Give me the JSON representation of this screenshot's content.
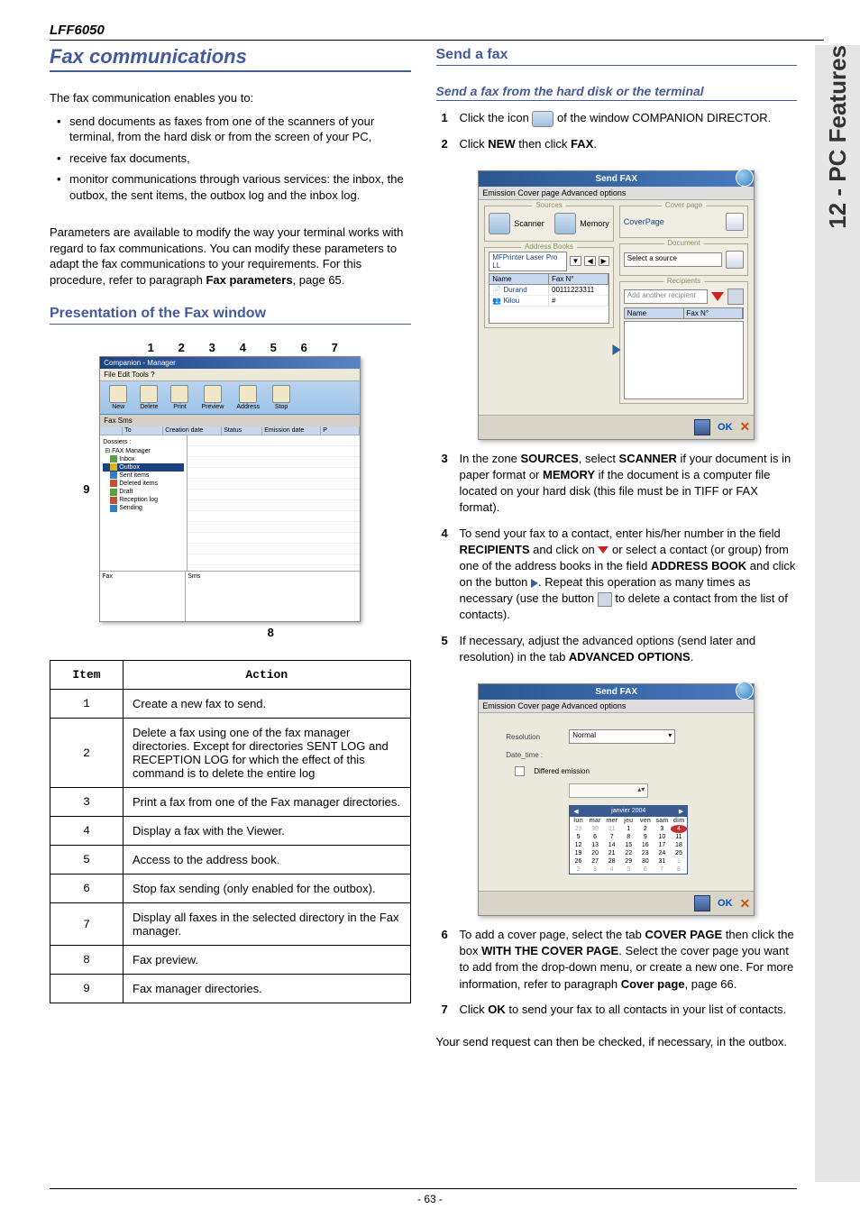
{
  "header_model": "LFF6050",
  "sidebar_text": "12 - PC Features",
  "page_number": "- 63 -",
  "left": {
    "main_title": "Fax communications",
    "intro": "The fax communication enables you to:",
    "bullets": [
      "send documents as faxes from one of the scanners of your terminal, from the hard disk or from the screen of your PC,",
      "receive fax documents,",
      "monitor communications through various services: the inbox, the outbox, the sent items, the outbox log and the inbox log."
    ],
    "params_para_1": "Parameters are available to modify the way your terminal works with regard to fax communications. You can modify these parameters to adapt the fax communications to your requirements. For this procedure, refer to paragraph ",
    "params_para_bold": "Fax parameters",
    "params_para_2": ", page 65.",
    "h2_presentation": "Presentation of the Fax window",
    "fig_top_nums": [
      "1",
      "2",
      "3",
      "4",
      "5",
      "6",
      "7"
    ],
    "fig_left_num": "9",
    "fig_bottom_num": "8",
    "fw": {
      "title": "Companion - Manager",
      "menu": "File   Edit   Tools   ?",
      "tools": [
        "New",
        "Delete",
        "Print",
        "Preview",
        "Address",
        "Stop"
      ],
      "tab_row": "Fax   Sms",
      "headers": [
        "",
        "To",
        "Creation date",
        "Status",
        "Emission date",
        "P"
      ],
      "tree_root": "Dossiers :",
      "tree_parent": "FAX Manager",
      "tree_items": [
        "Inbox",
        "Outbox",
        "Sent items",
        "Deleted items",
        "Draft",
        "Reception log",
        "Sending"
      ],
      "foot_left": "Fax",
      "foot_right": "Sms"
    },
    "table_head_item": "Item",
    "table_head_action": "Action",
    "table_rows": [
      {
        "n": "1",
        "a": "Create a new fax to send."
      },
      {
        "n": "2",
        "a": "Delete a fax using one of the fax manager directories. Except for directories SENT LOG and RECEPTION LOG for which the effect of this command is to delete the entire log"
      },
      {
        "n": "3",
        "a": "Print a fax from one of the Fax manager directories."
      },
      {
        "n": "4",
        "a": "Display a fax with the Viewer."
      },
      {
        "n": "5",
        "a": "Access to the address book."
      },
      {
        "n": "6",
        "a": "Stop fax sending (only enabled for the outbox)."
      },
      {
        "n": "7",
        "a": "Display all faxes in the selected directory in the Fax manager."
      },
      {
        "n": "8",
        "a": "Fax preview."
      },
      {
        "n": "9",
        "a": "Fax manager directories."
      }
    ]
  },
  "right": {
    "h2_send": "Send a fax",
    "h3_send_hdd": "Send a fax from the hard disk or the terminal",
    "step1_a": "Click the icon ",
    "step1_b": " of the window C",
    "step1_c": "OMPANION",
    "step1_d": " D",
    "step1_e": "IRECTOR",
    "step1_f": ".",
    "step2_a": "Click ",
    "step2_b": "NEW",
    "step2_c": " then click ",
    "step2_d": "FAX",
    "step2_e": ".",
    "sfd": {
      "title": "Send FAX",
      "tabs": "Emission   Cover page   Advanced options",
      "group_sources": "Sources",
      "scanner": "Scanner",
      "memory": "Memory",
      "group_addr": "Address Books",
      "addr_header_left": "MFPrinter Laser Pro LL",
      "addr_col_name": "Name",
      "addr_col_fax": "Fax N°",
      "addr_rows": [
        {
          "name": "Durand",
          "fax": "00111223311"
        },
        {
          "name": "Kilou",
          "fax": "#"
        }
      ],
      "group_cover": "Cover page",
      "cover_label": "CoverPage",
      "group_doc": "Document",
      "doc_select": "Select a source",
      "group_recip": "Recipients",
      "recip_add": "Add another recipient",
      "recip_col_name": "Name",
      "recip_col_fax": "Fax N°",
      "ok": "OK",
      "x": "✕"
    },
    "step3": {
      "a": "In the zone ",
      "b": "SOURCES",
      "c": ", select ",
      "d": "SCANNER",
      "e": " if your document is in paper format or ",
      "f": "MEMORY",
      "g": " if the document is a computer file located on your hard disk (this file must be in TIFF or FAX format)."
    },
    "step4": {
      "a": "To send your fax to a contact, enter his/her number in the field ",
      "b": "RECIPIENTS",
      "c": " and click on ",
      "d": " or select a contact (or group) from one of the address books in the field ",
      "e": "ADDRESS BOOK",
      "f": " and click on the button ",
      "g": ". Repeat this operation as many times as necessary (use the button ",
      "h": " to delete a contact from the list of contacts)."
    },
    "step5": {
      "a": "If necessary, adjust the advanced options (send later and resolution) in the tab ",
      "b": "ADVANCED OPTIONS",
      "c": "."
    },
    "adv": {
      "tabs": "Emission   Cover page   Advanced options",
      "label_res": "Resolution",
      "res_value": "Normal",
      "label_date": "Date_time :",
      "check_label": "Differed emission",
      "cal_month": "janvier 2004",
      "cal_dow": [
        "lun",
        "mar",
        "mer",
        "jeu",
        "ven",
        "sam",
        "dim"
      ],
      "cal_days": [
        [
          "29",
          "30",
          "31",
          "1",
          "2",
          "3",
          "4"
        ],
        [
          "5",
          "6",
          "7",
          "8",
          "9",
          "10",
          "11"
        ],
        [
          "12",
          "13",
          "14",
          "15",
          "16",
          "17",
          "18"
        ],
        [
          "19",
          "20",
          "21",
          "22",
          "23",
          "24",
          "25"
        ],
        [
          "26",
          "27",
          "28",
          "29",
          "30",
          "31",
          "1"
        ],
        [
          "2",
          "3",
          "4",
          "5",
          "6",
          "7",
          "8"
        ]
      ]
    },
    "step6": {
      "a": "To add a cover page, select the tab ",
      "b": "COVER PAGE",
      "c": " then click the box ",
      "d": "WITH THE COVER PAGE",
      "e": ". Select the cover page you want to add from the drop-down menu, or create a new one. For more information, refer to paragraph ",
      "f": "Cover page",
      "g": ", page 66."
    },
    "step7": {
      "a": "Click ",
      "b": "OK",
      "c": " to send your fax to all contacts in your list of contacts."
    },
    "closing": "Your send request can then be checked, if necessary, in the outbox."
  }
}
